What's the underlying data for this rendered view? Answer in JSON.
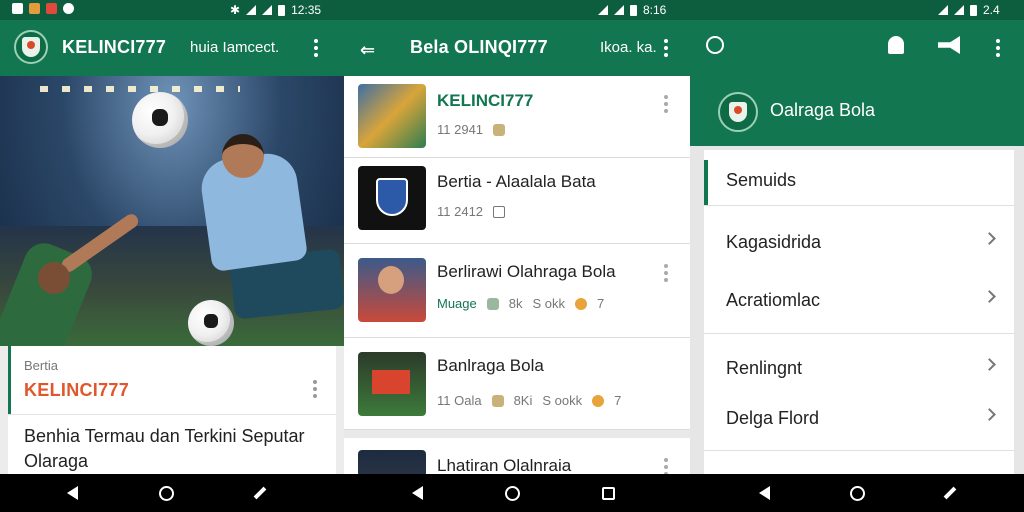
{
  "status_bar": {
    "left_time": "",
    "mid_time": "12:35",
    "right_time": "8:16",
    "far_right_time": "2.4"
  },
  "panel1": {
    "app_title": "KELINCI777",
    "app_subtitle": "huia Iamcect.",
    "news_card": {
      "category": "Bertia",
      "source": "KELINCI777",
      "headline": "Benhia Termau dan Terkini Seputar Olaraga"
    }
  },
  "panel2": {
    "app_title": "Bela OLINQI777",
    "app_subtitle": "Ikoa. ka.",
    "items": [
      {
        "title": "KELINCI777",
        "meta": [
          "11 2941"
        ],
        "title_color": "#127650"
      },
      {
        "title": "Bertia - Alaalala Bata",
        "meta": [
          "11 2412"
        ]
      },
      {
        "title": "Berlirawi Olahraga Bola",
        "meta": [
          "Muage",
          "8k",
          "S okk",
          "7"
        ]
      },
      {
        "title": "Banlraga Bola",
        "meta": [
          "11 Oala",
          "8Ki",
          "S ookk",
          "7"
        ]
      },
      {
        "title": "Lhatiran Olalnraia",
        "meta": []
      }
    ]
  },
  "panel3": {
    "drawer_title": "Oalraga Bola",
    "menu": [
      {
        "label": "Semuids",
        "active": true
      },
      {
        "label": "Kagasidrida",
        "active": false
      },
      {
        "label": "Acratiomlac",
        "active": false
      },
      {
        "label": "Renlingnt",
        "active": false
      },
      {
        "label": "Delga Flord",
        "active": false
      }
    ]
  },
  "colors": {
    "app_bar": "#127650",
    "status_bar": "#0d5e3f",
    "accent_orange": "#e0572c"
  },
  "icons": [
    "back-arrow-icon",
    "search-icon",
    "bell-icon",
    "megaphone-icon",
    "more-vert-icon",
    "chevron-right-icon",
    "nav-back-icon",
    "nav-home-icon",
    "nav-recents-icon"
  ]
}
